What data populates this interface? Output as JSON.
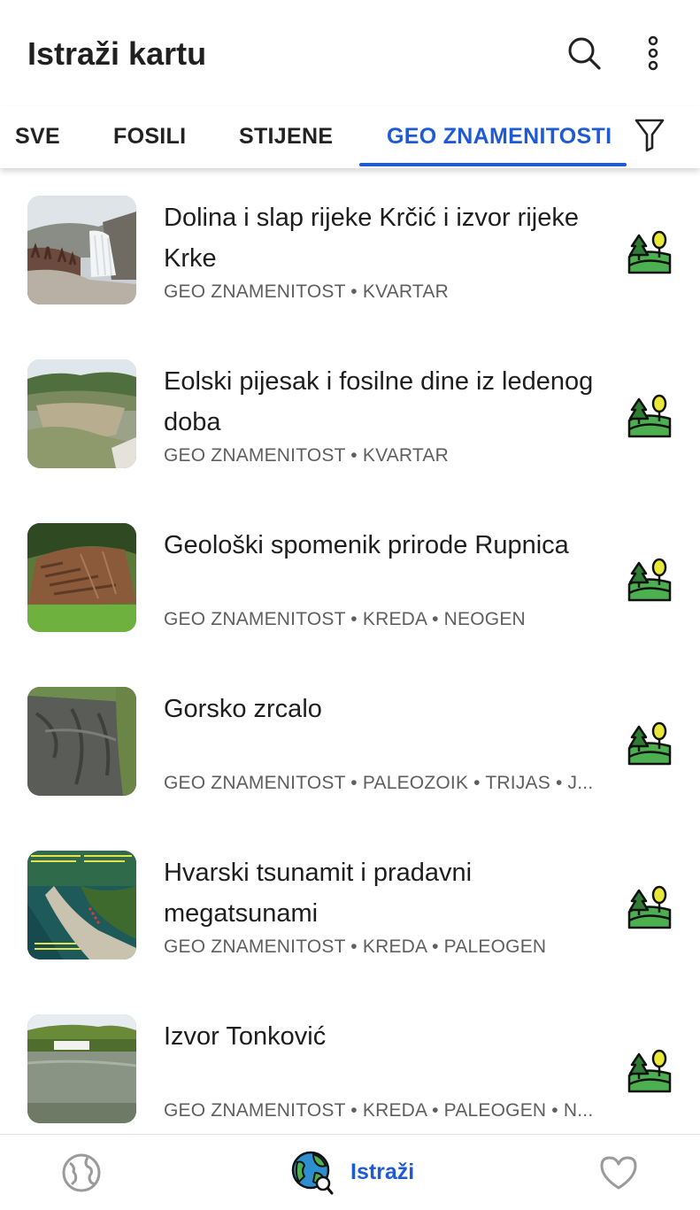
{
  "app": {
    "title": "Istraži kartu"
  },
  "tabs": [
    {
      "label": "SVE",
      "active": false
    },
    {
      "label": "FOSILI",
      "active": false
    },
    {
      "label": "STIJENE",
      "active": false
    },
    {
      "label": "GEO ZNAMENITOSTI",
      "active": true
    }
  ],
  "items": [
    {
      "title": "Dolina i slap rijeke Krčić i izvor rijeke Krke",
      "meta": "GEO ZNAMENITOST • KVARTAR"
    },
    {
      "title": "Eolski pijesak i fosilne dine iz ledenog doba",
      "meta": "GEO ZNAMENITOST • KVARTAR"
    },
    {
      "title": "Geološki spomenik prirode Rupnica",
      "meta": "GEO ZNAMENITOST • KREDA • NEOGEN"
    },
    {
      "title": "Gorsko zrcalo",
      "meta": "GEO ZNAMENITOST • PALEOZOIK • TRIJAS • J..."
    },
    {
      "title": "Hvarski tsunamit i pradavni megatsunami",
      "meta": "GEO ZNAMENITOST • KREDA • PALEOGEN"
    },
    {
      "title": "Izvor Tonković",
      "meta": "GEO ZNAMENITOST • KREDA • PALEOGEN • N..."
    }
  ],
  "bottom_nav": {
    "explore_label": "Istraži"
  },
  "colors": {
    "accent": "#1f5ad6",
    "icon_green": "#4caf50",
    "icon_yellow": "#e8e83a"
  }
}
